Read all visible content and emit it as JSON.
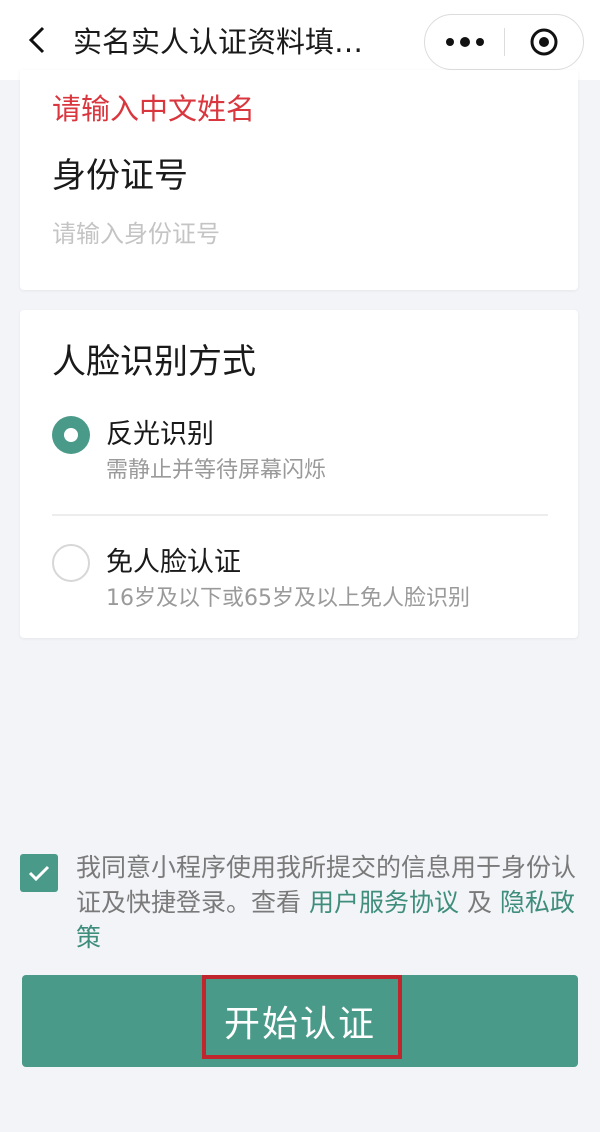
{
  "header": {
    "title": "实名实人认证资料填…",
    "icons": {
      "back": "chevron-left-icon",
      "more": "more-dots-icon",
      "close": "target-close-icon"
    }
  },
  "identity_card": {
    "name_error": "请输入中文姓名",
    "id_label": "身份证号",
    "id_input": {
      "value": "",
      "placeholder": "请输入身份证号"
    }
  },
  "face_card": {
    "title": "人脸识别方式",
    "options": [
      {
        "title": "反光识别",
        "desc": "需静止并等待屏幕闪烁",
        "selected": true
      },
      {
        "title": "免人脸认证",
        "desc": "16岁及以下或65岁及以上免人脸识别",
        "selected": false
      }
    ]
  },
  "agreement": {
    "checked": true,
    "text": "我同意小程序使用我所提交的信息用于身份认证及快捷登录。查看",
    "link_terms": "用户服务协议",
    "and": "及",
    "link_privacy": "隐私政策"
  },
  "submit": {
    "label": "开始认证"
  },
  "colors": {
    "accent": "#4a9a8a",
    "error": "#d9363e",
    "highlight": "#c0262d",
    "link": "#3f8e7d"
  }
}
